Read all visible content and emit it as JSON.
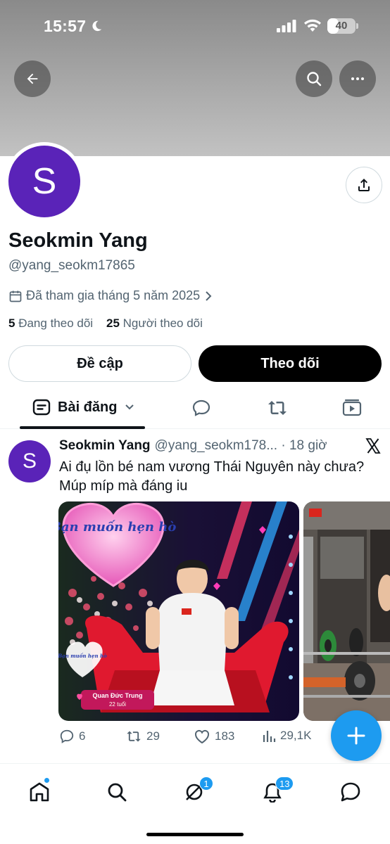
{
  "status_bar": {
    "time": "15:57",
    "battery": "40",
    "battery_level": 0.4
  },
  "profile": {
    "avatar_letter": "S",
    "display_name": "Seokmin Yang",
    "handle": "@yang_seokm17865",
    "joined": "Đã tham gia tháng 5 năm 2025",
    "following_count": "5",
    "following_label": "Đang theo dõi",
    "followers_count": "25",
    "followers_label": "Người theo dõi"
  },
  "buttons": {
    "mention": "Đề cập",
    "follow": "Theo dõi"
  },
  "tabs": {
    "posts": "Bài đăng"
  },
  "post": {
    "avatar_letter": "S",
    "name": "Seokmin Yang",
    "meta": "@yang_seokm178... · 18 giờ",
    "text": "Ai đụ lồn bé nam vương Thái Nguyên này chưa? Múp míp mà đáng iu",
    "media_show_title": "Bạn muốn hẹn hò",
    "media_show_title_small": "Bạn muốn hẹn hò",
    "media_caption_name": "Quan Đức Trung",
    "media_caption_age": "22 tuổi",
    "replies": "6",
    "reposts": "29",
    "likes": "183",
    "views": "29,1K"
  },
  "nav": {
    "messages_badge": "1",
    "notifications_badge": "13"
  },
  "colors": {
    "accent": "#1d9bf0",
    "avatar": "#5a23b8",
    "text": "#0f1419",
    "muted": "#536471"
  }
}
